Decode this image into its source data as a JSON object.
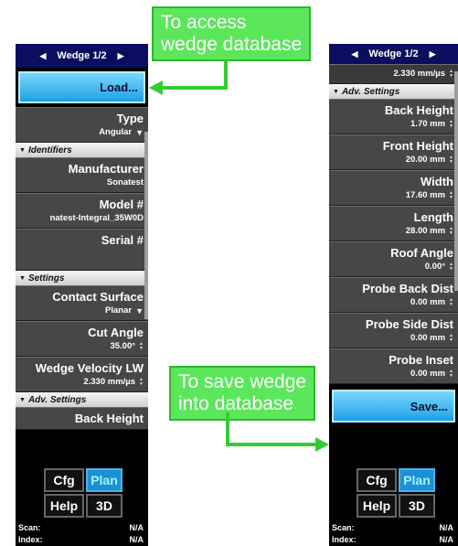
{
  "left_panel": {
    "title": "Wedge 1/2",
    "load_label": "Load...",
    "rows": [
      {
        "kind": "field",
        "name": "type-field",
        "label": "Type",
        "value": "Angular",
        "ctl": "drop"
      },
      {
        "kind": "section",
        "label": "Identifiers"
      },
      {
        "kind": "field",
        "name": "manufacturer-field",
        "label": "Manufacturer",
        "value": "Sonatest",
        "ctl": ""
      },
      {
        "kind": "field",
        "name": "model-field",
        "label": "Model #",
        "value": "natest-Integral_35W0D",
        "ctl": ""
      },
      {
        "kind": "field",
        "name": "serial-field",
        "label": "Serial #",
        "value": "",
        "ctl": "",
        "tall": true
      },
      {
        "kind": "section",
        "label": "Settings"
      },
      {
        "kind": "field",
        "name": "contact-surface-field",
        "label": "Contact Surface",
        "value": "Planar",
        "ctl": "drop"
      },
      {
        "kind": "field",
        "name": "cut-angle-field",
        "label": "Cut Angle",
        "value": "35.00°",
        "ctl": "spin"
      },
      {
        "kind": "field",
        "name": "wedge-velocity-field",
        "label": "Wedge Velocity LW",
        "value": "2.330 mm/µs",
        "ctl": "spin"
      },
      {
        "kind": "section",
        "label": "Adv. Settings"
      },
      {
        "kind": "field",
        "name": "back-height-field",
        "label": "Back Height",
        "value": "",
        "ctl": ""
      }
    ],
    "scan_label": "Scan:",
    "scan_value": "N/A",
    "index_label": "Index:",
    "index_value": "N/A"
  },
  "right_panel": {
    "title": "Wedge 1/2",
    "top_value": "2.330 mm/µs",
    "save_label": "Save...",
    "rows": [
      {
        "kind": "section",
        "label": "Adv. Settings"
      },
      {
        "kind": "field",
        "name": "back-height-field",
        "label": "Back Height",
        "value": "1.70 mm",
        "ctl": "spin"
      },
      {
        "kind": "field",
        "name": "front-height-field",
        "label": "Front Height",
        "value": "20.00 mm",
        "ctl": "spin"
      },
      {
        "kind": "field",
        "name": "width-field",
        "label": "Width",
        "value": "17.60 mm",
        "ctl": "spin"
      },
      {
        "kind": "field",
        "name": "length-field",
        "label": "Length",
        "value": "28.00 mm",
        "ctl": "spin"
      },
      {
        "kind": "field",
        "name": "roof-angle-field",
        "label": "Roof Angle",
        "value": "0.00°",
        "ctl": "spin"
      },
      {
        "kind": "field",
        "name": "probe-back-dist-field",
        "label": "Probe Back Dist",
        "value": "0.00 mm",
        "ctl": "spin"
      },
      {
        "kind": "field",
        "name": "probe-side-dist-field",
        "label": "Probe Side Dist",
        "value": "0.00 mm",
        "ctl": "spin"
      },
      {
        "kind": "field",
        "name": "probe-inset-field",
        "label": "Probe Inset",
        "value": "0.00 mm",
        "ctl": "spin"
      }
    ],
    "scan_label": "Scan:",
    "scan_value": "N/A",
    "index_label": "Index:",
    "index_value": "N/A"
  },
  "dock": {
    "cfg": "Cfg",
    "plan": "Plan",
    "help": "Help",
    "threed": "3D"
  },
  "callouts": {
    "access_line1": "To access",
    "access_line2": "wedge database",
    "save_line1": "To save wedge",
    "save_line2": "into database"
  },
  "colors": {
    "callout_green": "#5ce65c",
    "arrow_green": "#33cc33",
    "title_navy": "#0b0d5e",
    "button_blue": "#1ea2e2"
  }
}
